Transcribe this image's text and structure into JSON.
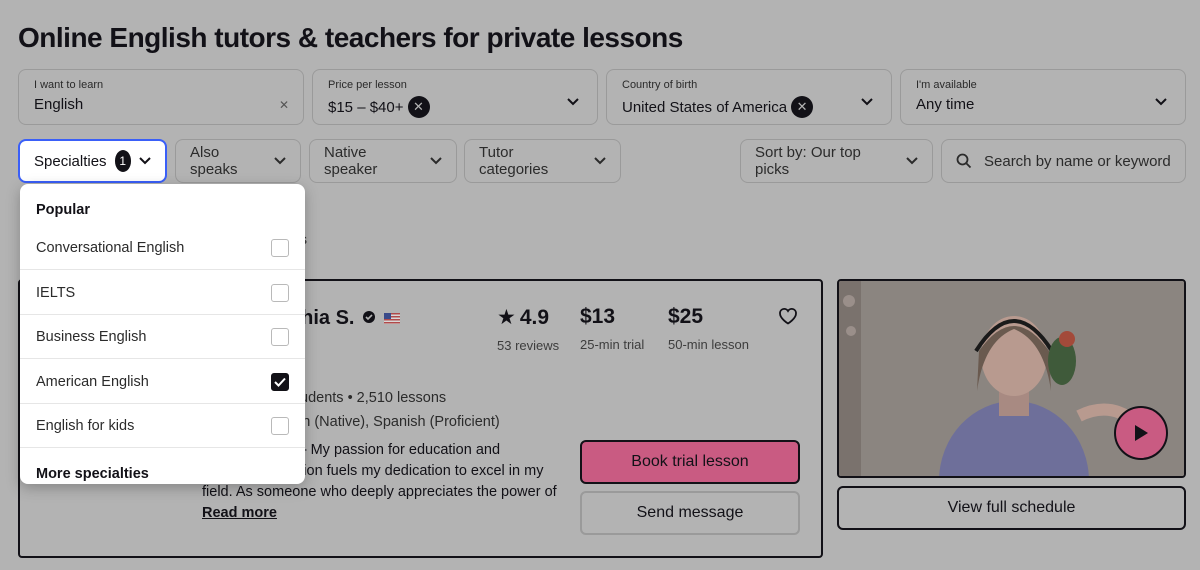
{
  "page": {
    "title": "Online English tutors & teachers for private lessons"
  },
  "filters": {
    "learn": {
      "label": "I want to learn",
      "value": "English"
    },
    "price": {
      "label": "Price per lesson",
      "value": "$15 – $40+"
    },
    "country": {
      "label": "Country of birth",
      "value": "United States of America"
    },
    "available": {
      "label": "I'm available",
      "value": "Any time"
    }
  },
  "pills": {
    "specialties": {
      "label": "Specialties",
      "count": "1"
    },
    "also_speaks": "Also speaks",
    "native": "Native speaker",
    "categories": "Tutor categories",
    "sort": "Sort by: Our top picks",
    "search_placeholder": "Search by name or keyword"
  },
  "behind": {
    "partial_heading_fragment": "s"
  },
  "tutor": {
    "name_fragment": "chia S.",
    "rating": "4.9",
    "reviews": "53 reviews",
    "trial_price": "$13",
    "trial_label": "25-min trial",
    "lesson_price": "$25",
    "lesson_label": "50-min lesson",
    "stats_fragment": "udents • 2,510 lessons",
    "languages_fragment": "sh (Native), Spanish (Proficient)",
    "desc_line1": "! — My passion for education and",
    "desc_line2": "ction fuels my dedication to excel in my",
    "desc_line3": "field. As someone who deeply appreciates the power of",
    "read_more": "Read more",
    "book_label": "Book trial lesson",
    "message_label": "Send message",
    "schedule_label": "View full schedule"
  },
  "dropdown": {
    "section": "Popular",
    "items": [
      {
        "label": "Conversational English",
        "checked": false
      },
      {
        "label": "IELTS",
        "checked": false
      },
      {
        "label": "Business English",
        "checked": false
      },
      {
        "label": "American English",
        "checked": true
      },
      {
        "label": "English for kids",
        "checked": false
      }
    ],
    "more": "More specialties"
  },
  "colors": {
    "accent_pink": "#c95b82",
    "focus_blue": "#3a5ff8",
    "overlay_gray": "#b3b3b3"
  }
}
